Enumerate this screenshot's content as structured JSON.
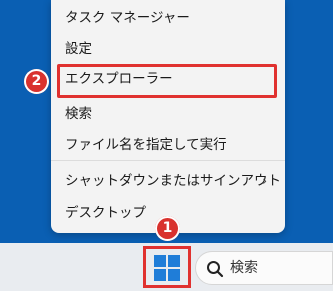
{
  "menu": {
    "items": [
      {
        "label": "タスク マネージャー"
      },
      {
        "label": "設定"
      },
      {
        "label": "エクスプローラー"
      },
      {
        "label": "検索"
      },
      {
        "label": "ファイル名を指定して実行"
      },
      {
        "label": "シャットダウンまたはサインアウト",
        "chevron": "›"
      },
      {
        "label": "デスクトップ"
      }
    ]
  },
  "annotations": {
    "badge_1": "1",
    "badge_2": "2"
  },
  "taskbar": {
    "search_placeholder": "検索"
  },
  "colors": {
    "desktop": "#0a5fb3",
    "accent_red": "#e0312f",
    "windows_blue": "#1f7dd8"
  },
  "icons": {
    "start": "windows-logo-icon",
    "search": "search-icon",
    "chevron": "chevron-right-icon"
  }
}
